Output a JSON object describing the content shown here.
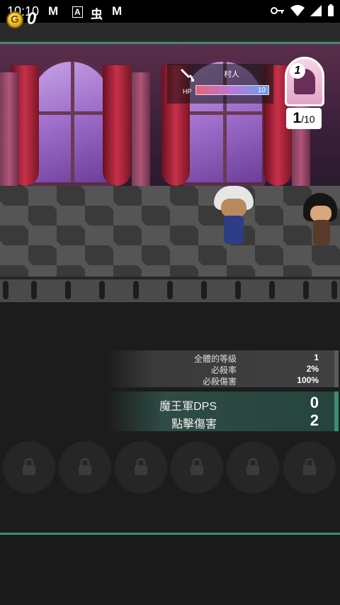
{
  "status_bar": {
    "time": "10:10",
    "app_icons": [
      "M",
      "A",
      "虫",
      "M"
    ]
  },
  "top_bar": {
    "coin_symbol": "G",
    "coin_count": "0"
  },
  "enemy": {
    "name": "村人",
    "hp_label": "HP",
    "hp_value": "10",
    "hp_fraction": 1.0
  },
  "wave": {
    "badge_number": "1",
    "current": "1",
    "separator": "/",
    "total": "10"
  },
  "stats": [
    {
      "label": "全體的等級",
      "value": "1"
    },
    {
      "label": "必殺率",
      "value": "2%"
    },
    {
      "label": "必殺傷害",
      "value": "100%"
    }
  ],
  "dps": [
    {
      "label": "魔王軍DPS",
      "value": "0"
    },
    {
      "label": "點擊傷害",
      "value": "2"
    }
  ],
  "locked_slots": [
    "lock-icon",
    "lock-icon",
    "lock-icon",
    "lock-icon",
    "lock-icon",
    "lock-icon"
  ],
  "colors": {
    "accent": "#3c8f6e",
    "coin": "#e7b012"
  }
}
